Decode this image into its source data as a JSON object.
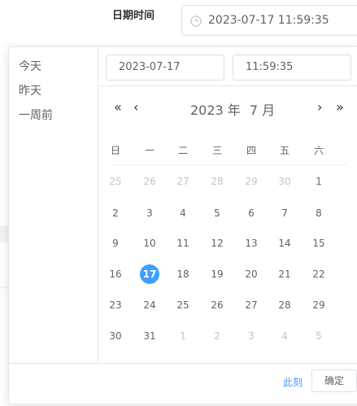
{
  "form": {
    "label": "日期时间",
    "value": "2023-07-17 11:59:35"
  },
  "picker": {
    "date_input": "2023-07-17",
    "time_input": "11:59:35",
    "shortcuts": [
      "今天",
      "昨天",
      "一周前"
    ],
    "nav": {
      "prev_year": "«",
      "prev_month": "‹",
      "next_month": "›",
      "next_year": "»"
    },
    "header": {
      "year": "2023 年",
      "month": "7 月"
    },
    "weekdays": [
      "日",
      "一",
      "二",
      "三",
      "四",
      "五",
      "六"
    ],
    "weeks": [
      [
        {
          "d": "25",
          "other": true
        },
        {
          "d": "26",
          "other": true
        },
        {
          "d": "27",
          "other": true
        },
        {
          "d": "28",
          "other": true
        },
        {
          "d": "29",
          "other": true
        },
        {
          "d": "30",
          "other": true
        },
        {
          "d": "1"
        }
      ],
      [
        {
          "d": "2"
        },
        {
          "d": "3"
        },
        {
          "d": "4"
        },
        {
          "d": "5"
        },
        {
          "d": "6"
        },
        {
          "d": "7"
        },
        {
          "d": "8"
        }
      ],
      [
        {
          "d": "9"
        },
        {
          "d": "10"
        },
        {
          "d": "11"
        },
        {
          "d": "12"
        },
        {
          "d": "13"
        },
        {
          "d": "14"
        },
        {
          "d": "15"
        }
      ],
      [
        {
          "d": "16"
        },
        {
          "d": "17",
          "selected": true
        },
        {
          "d": "18"
        },
        {
          "d": "19"
        },
        {
          "d": "20"
        },
        {
          "d": "21"
        },
        {
          "d": "22"
        }
      ],
      [
        {
          "d": "23"
        },
        {
          "d": "24"
        },
        {
          "d": "25"
        },
        {
          "d": "26"
        },
        {
          "d": "27"
        },
        {
          "d": "28"
        },
        {
          "d": "29"
        }
      ],
      [
        {
          "d": "30"
        },
        {
          "d": "31"
        },
        {
          "d": "1",
          "other": true
        },
        {
          "d": "2",
          "other": true
        },
        {
          "d": "3",
          "other": true
        },
        {
          "d": "4",
          "other": true
        },
        {
          "d": "5",
          "other": true
        }
      ]
    ],
    "footer": {
      "now": "此刻",
      "confirm": "确定"
    }
  },
  "colors": {
    "primary": "#409eff",
    "muted": "#c0c4cc",
    "border": "#dcdfe6"
  }
}
